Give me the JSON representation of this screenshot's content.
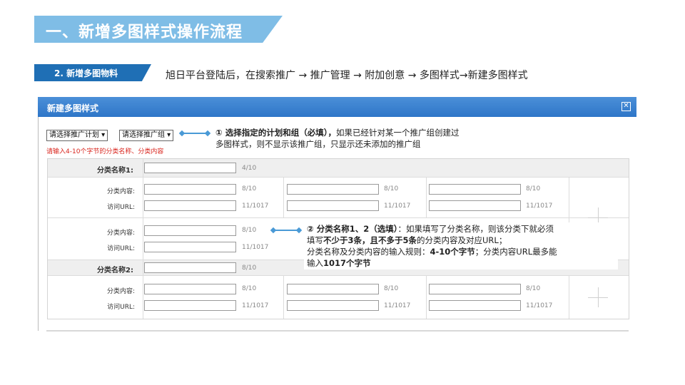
{
  "slide": {
    "title": "一、新增多图样式操作流程",
    "step_label": "2. 新增多图物料",
    "path_text": "旭日平台登陆后，在搜索推广 → 推广管理 → 附加创意 → 多图样式→新建多图样式"
  },
  "dialog": {
    "title": "新建多图样式",
    "close_glyph": "✕",
    "plan_select": "请选择推广计划 ▾",
    "group_select": "请选择推广组 ▾",
    "warning": "请输入4-10个字节的分类名称、分类内容",
    "category1_label": "分类名称1:",
    "category1_count": "4/10",
    "content_label": "分类内容:",
    "url_label": "访问URL:",
    "content_count": "8/10",
    "url_count": "11/1017",
    "category2_label": "分类名称2:",
    "category2_count": "8/10",
    "plus_glyph": "+"
  },
  "notes": {
    "note1_bold": "① 选择指定的计划和组（必填），",
    "note1_rest": "如果已经针对某一个推广组创建过",
    "note1_line2": "多图样式，则不显示该推广组，只显示还未添加的推广组",
    "note2_bold": "② 分类名称1、2（选填）",
    "note2_rest": "：如果填写了分类名称，则该分类下就必须",
    "note2_line2_a": "填写",
    "note2_line2_b": "不少于3条，且不多于5条",
    "note2_line2_c": "的分类内容及对应URL；",
    "note2_line3_a": "分类名称及分类内容的输入规则：",
    "note2_line3_b": "4-10个字节",
    "note2_line3_c": "；分类内容URL最多能",
    "note2_line4_a": "输入",
    "note2_line4_b": "1017个字节"
  },
  "colors": {
    "title_banner": "#7fbde6",
    "step_banner": "#1f6fb5",
    "dialog_header": "#3a80cf",
    "warning_text": "#d9251d",
    "connector": "#4a9ad6"
  }
}
